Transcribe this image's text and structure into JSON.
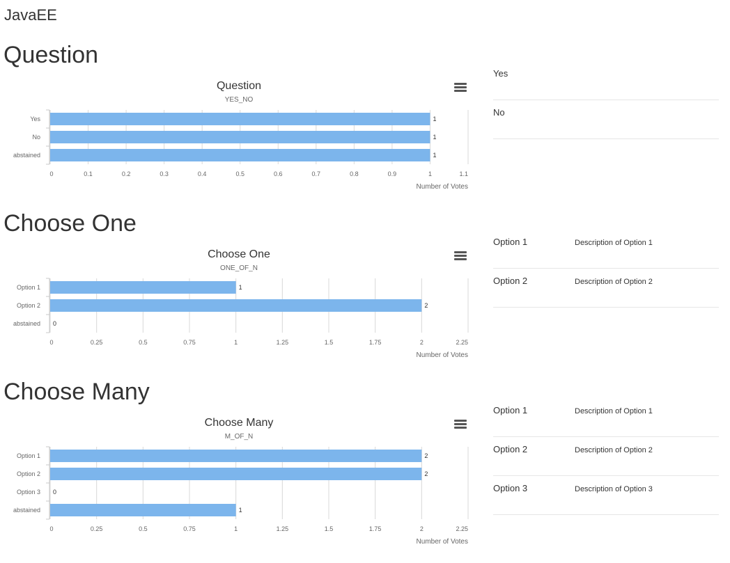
{
  "app": {
    "title": "JavaEE"
  },
  "ui": {
    "menu_icon": "hamburger-menu-icon"
  },
  "colors": {
    "bar": "#7cb5ec",
    "grid": "#d8d8d8",
    "text": "#333333",
    "axis_text": "#666666"
  },
  "sections": [
    {
      "heading": "Question",
      "options": [
        {
          "label": "Yes"
        },
        {
          "label": "No"
        }
      ]
    },
    {
      "heading": "Choose One",
      "options": [
        {
          "label": "Option 1",
          "description": "Description of Option 1"
        },
        {
          "label": "Option 2",
          "description": "Description of Option 2"
        }
      ]
    },
    {
      "heading": "Choose Many",
      "options": [
        {
          "label": "Option 1",
          "description": "Description of Option 1"
        },
        {
          "label": "Option 2",
          "description": "Description of Option 2"
        },
        {
          "label": "Option 3",
          "description": "Description of Option 3"
        }
      ]
    }
  ],
  "chart_data": [
    {
      "type": "bar",
      "orientation": "horizontal",
      "title": "Question",
      "subtitle": "YES_NO",
      "categories": [
        "Yes",
        "No",
        "abstained"
      ],
      "values": [
        1,
        1,
        1
      ],
      "xlabel": "Number of Votes",
      "ticks": [
        "0",
        "0.1",
        "0.2",
        "0.3",
        "0.4",
        "0.5",
        "0.6",
        "0.7",
        "0.8",
        "0.9",
        "1",
        "1.1"
      ],
      "xlim": [
        0,
        1.1
      ],
      "grid": true,
      "data_labels": true
    },
    {
      "type": "bar",
      "orientation": "horizontal",
      "title": "Choose One",
      "subtitle": "ONE_OF_N",
      "categories": [
        "Option 1",
        "Option 2",
        "abstained"
      ],
      "values": [
        1,
        2,
        0
      ],
      "xlabel": "Number of Votes",
      "ticks": [
        "0",
        "0.25",
        "0.5",
        "0.75",
        "1",
        "1.25",
        "1.5",
        "1.75",
        "2",
        "2.25"
      ],
      "xlim": [
        0,
        2.25
      ],
      "grid": true,
      "data_labels": true
    },
    {
      "type": "bar",
      "orientation": "horizontal",
      "title": "Choose Many",
      "subtitle": "M_OF_N",
      "categories": [
        "Option 1",
        "Option 2",
        "Option 3",
        "abstained"
      ],
      "values": [
        2,
        2,
        0,
        1
      ],
      "xlabel": "Number of Votes",
      "ticks": [
        "0",
        "0.25",
        "0.5",
        "0.75",
        "1",
        "1.25",
        "1.5",
        "1.75",
        "2",
        "2.25"
      ],
      "xlim": [
        0,
        2.25
      ],
      "grid": true,
      "data_labels": true
    }
  ]
}
